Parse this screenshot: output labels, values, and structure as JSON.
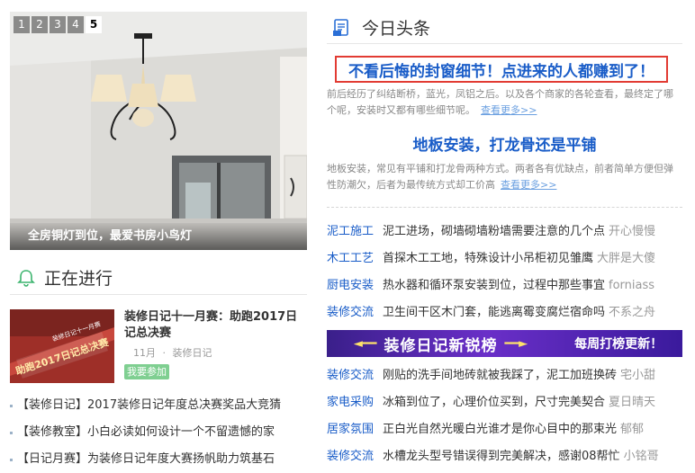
{
  "slider": {
    "dots": [
      "1",
      "2",
      "3",
      "4",
      "5"
    ],
    "active_index": 4,
    "caption": "全房铜灯到位，最爱书房小鸟灯"
  },
  "ongoing": {
    "title": "正在进行",
    "feature": {
      "title": "装修日记十一月赛：助跑2017日记总决赛",
      "month": "11月",
      "source": "装修日记",
      "join_label": "我要参加",
      "thumb_text": "助跑2017日记总决赛",
      "thumb_sub": "装修日记十一月赛"
    },
    "list": [
      "【装修日记】2017装修日记年度总决赛奖品大竞猜",
      "【装修教室】小白必读如何设计一个不留遗憾的家",
      "【日记月赛】为装修日记年度大赛扬帆助力筑基石"
    ]
  },
  "headlines": {
    "title": "今日头条",
    "top": {
      "title": "不看后悔的封窗细节！点进来的人都赚到了！",
      "summary": "前后经历了纠结断桥，蓝光，凤铝之后。以及各个商家的各轮查看，最终定了哪个呢，安装时又都有哪些细节呢。",
      "more": "查看更多>>"
    },
    "second": {
      "title": "地板安装，打龙骨还是平铺",
      "summary": "地板安装，常见有平铺和打龙骨两种方式。两者各有优缺点，前者简单方便但弹性防潮欠，后者为最传统方式却工价高",
      "more": "查看更多>>"
    }
  },
  "category_list_1": [
    {
      "cat": "泥工施工",
      "text": "泥工进场，砌墙砌墙粉墙需要注意的几个点",
      "author": "开心慢慢"
    },
    {
      "cat": "木工工艺",
      "text": "首探木工工地，特殊设计小吊柜初见雏鹰",
      "author": "大胖是大傻"
    },
    {
      "cat": "厨电安装",
      "text": "热水器和循环泵安装到位，过程中那些事宜",
      "author": "forniass"
    },
    {
      "cat": "装修交流",
      "text": "卫生间干区木门套，能逃离霉变腐烂宿命吗",
      "author": "不系之舟"
    }
  ],
  "banner": {
    "text": "装修日记新锐榜",
    "sub": "每周打榜更新！",
    "arrow_left": "◄━━",
    "arrow_right": "━━►"
  },
  "category_list_2": [
    {
      "cat": "装修交流",
      "text": "刚贴的洗手间地砖就被我踩了，泥工加班换砖",
      "author": "宅小甜"
    },
    {
      "cat": "家电采购",
      "text": "冰箱到位了，心理价位买到，尺寸完美契合",
      "author": "夏日晴天"
    },
    {
      "cat": "居家氛围",
      "text": "正白光自然光暖白光谁才是你心目中的那束光",
      "author": "郁郁"
    },
    {
      "cat": "装修交流",
      "text": "水槽龙头型号错误得到完美解决，感谢08帮忙",
      "author": "小铭哥"
    }
  ],
  "colors": {
    "link_blue": "#1a5dc8",
    "headline_border": "#e23b33",
    "join_green": "#7fcf91",
    "banner_purple": "#5a2cb8"
  },
  "icons": {
    "section_ongoing": "bell-icon",
    "section_headlines": "newspaper-icon"
  }
}
